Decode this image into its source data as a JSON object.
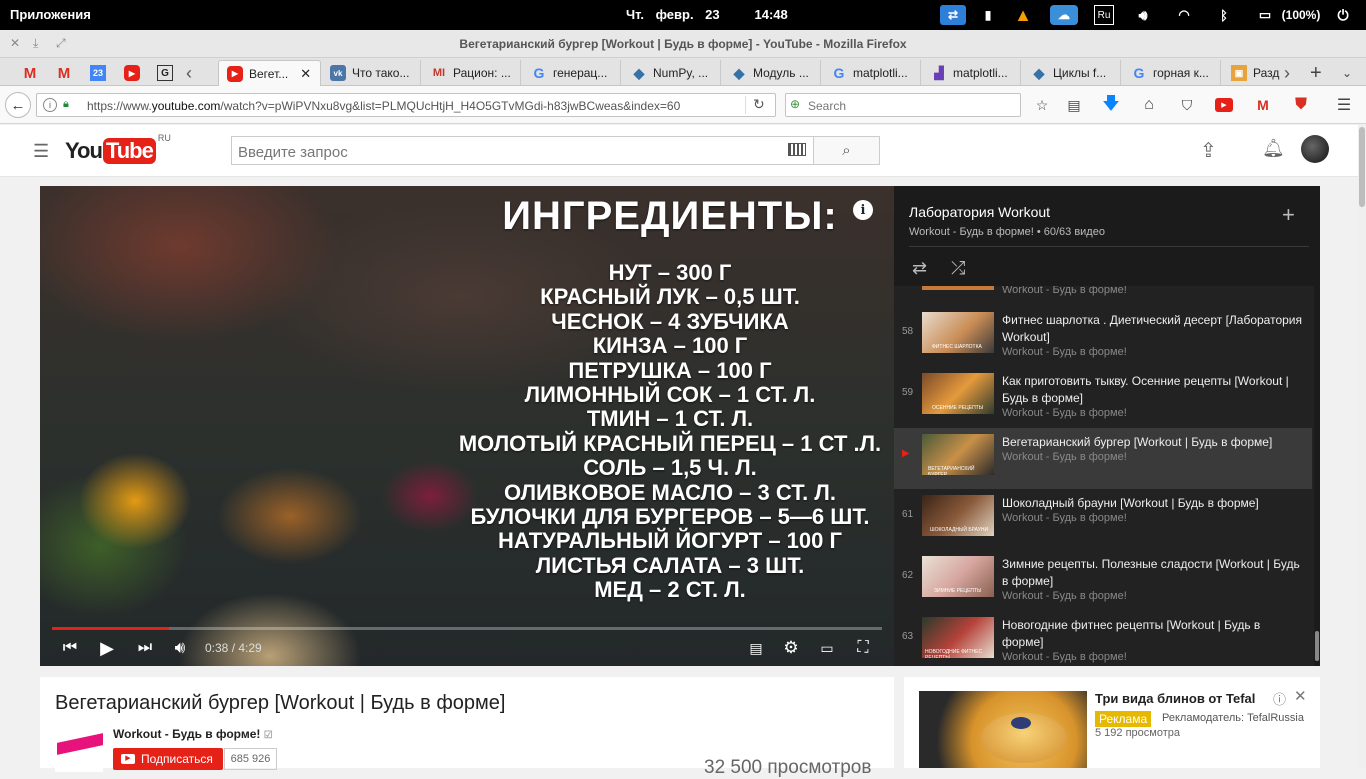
{
  "system": {
    "apps_label": "Приложения",
    "date": "Чт. февр. 23",
    "time": "14:48",
    "keyboard": "Ru",
    "battery": "(100%)"
  },
  "window": {
    "title": "Вегетарианский бургер [Workout | Будь в форме] - YouTube - Mozilla Firefox"
  },
  "tabs": [
    {
      "label": "Вегет...",
      "icon": "youtube-icon"
    },
    {
      "label": "Что тако...",
      "icon": "vk-icon"
    },
    {
      "label": "Рацион: ...",
      "icon": "mail-icon"
    },
    {
      "label": "генерац...",
      "icon": "google-icon"
    },
    {
      "label": "NumPy, ...",
      "icon": "python-icon"
    },
    {
      "label": "Модуль ...",
      "icon": "python-icon"
    },
    {
      "label": "matplotli...",
      "icon": "google-icon"
    },
    {
      "label": "matplotli...",
      "icon": "matplotlib-icon"
    },
    {
      "label": "Циклы f...",
      "icon": "python-icon"
    },
    {
      "label": "горная к...",
      "icon": "google-icon"
    },
    {
      "label": "Разд",
      "icon": "bookmark-icon"
    }
  ],
  "pinned_tabs": {
    "calendar_day": "23"
  },
  "nav": {
    "url_prefix": "https://www.",
    "url_domain": "youtube.com",
    "url_rest": "/watch?v=pWiPVNxu8vg&list=PLMQUcHtjH_H4O5GTvMGdi-h83jwBCweas&index=60",
    "search_placeholder": "Search"
  },
  "youtube": {
    "logo_you": "You",
    "logo_tube": "Tube",
    "logo_region": "RU",
    "search_placeholder": "Введите запрос"
  },
  "video": {
    "heading": "ИНГРЕДИЕНТЫ:",
    "lines": [
      "НУТ – 300 Г",
      "КРАСНЫЙ ЛУК – 0,5 ШТ.",
      "ЧЕСНОК – 4 ЗУБЧИКА",
      "КИНЗА – 100 Г",
      "ПЕТРУШКА – 100 Г",
      "ЛИМОННЫЙ СОК – 1 СТ. Л.",
      "ТМИН – 1 СТ. Л.",
      "МОЛОТЫЙ КРАСНЫЙ ПЕРЕЦ – 1 СТ .Л.",
      "СОЛЬ – 1,5 Ч. Л.",
      "ОЛИВКОВОЕ МАСЛО – 3 СТ. Л.",
      "БУЛОЧКИ ДЛЯ БУРГЕРОВ – 5—6 ШТ.",
      "НАТУРАЛЬНЫЙ ЙОГУРТ – 100 Г",
      "ЛИСТЬЯ САЛАТА – 3 ШТ.",
      "МЕД – 2 СТ. Л."
    ],
    "time": "0:38 / 4:29",
    "progress": 0.141
  },
  "playlist": {
    "title": "Лаборатория Workout",
    "subtitle": "Workout - Будь в форме! • 60/63 видео",
    "partial_channel": "Workout - Будь в форме!",
    "items": [
      {
        "num": "58",
        "title": "Фитнес шарлотка . Диетический десерт [Лаборатория Workout]",
        "channel": "Workout - Будь в форме!",
        "thumb_caption": "ФИТНЕС ШАРЛОТКА"
      },
      {
        "num": "59",
        "title": "Как приготовить тыкву. Осенние рецепты [Workout | Будь в форме]",
        "channel": "Workout - Будь в форме!",
        "thumb_caption": "ОСЕННИЕ РЕЦЕПТЫ"
      },
      {
        "num": "▶",
        "title": "Вегетарианский бургер [Workout | Будь в форме]",
        "channel": "Workout - Будь в форме!",
        "thumb_caption": "ВЕГЕТАРИАНСКИЙ БУРГЕР"
      },
      {
        "num": "61",
        "title": "Шоколадный брауни [Workout | Будь в форме]",
        "channel": "Workout - Будь в форме!",
        "thumb_caption": "ШОКОЛАДНЫЙ БРАУНИ"
      },
      {
        "num": "62",
        "title": "Зимние рецепты. Полезные сладости [Workout | Будь в форме]",
        "channel": "Workout - Будь в форме!",
        "thumb_caption": "ЗИМНИЕ РЕЦЕПТЫ"
      },
      {
        "num": "63",
        "title": "Новогодние фитнес рецепты [Workout | Будь в форме]",
        "channel": "Workout - Будь в форме!",
        "thumb_caption": "НОВОГОДНИЕ ФИТНЕС РЕЦЕПТЫ"
      }
    ]
  },
  "info": {
    "title": "Вегетарианский бургер [Workout | Будь в форме]",
    "channel": "Workout - Будь в форме!",
    "subscribe": "Подписаться",
    "subscribers": "685 926",
    "views": "32 500 просмотров"
  },
  "ad": {
    "title": "Три вида блинов от Tefal",
    "badge": "Реклама",
    "advertiser": "Рекламодатель: TefalRussia",
    "views": "5 192 просмотра"
  },
  "colors": {
    "yt_red": "#e62117",
    "ad_yellow": "#e6b800",
    "firefox_blue": "#0a84ff"
  }
}
